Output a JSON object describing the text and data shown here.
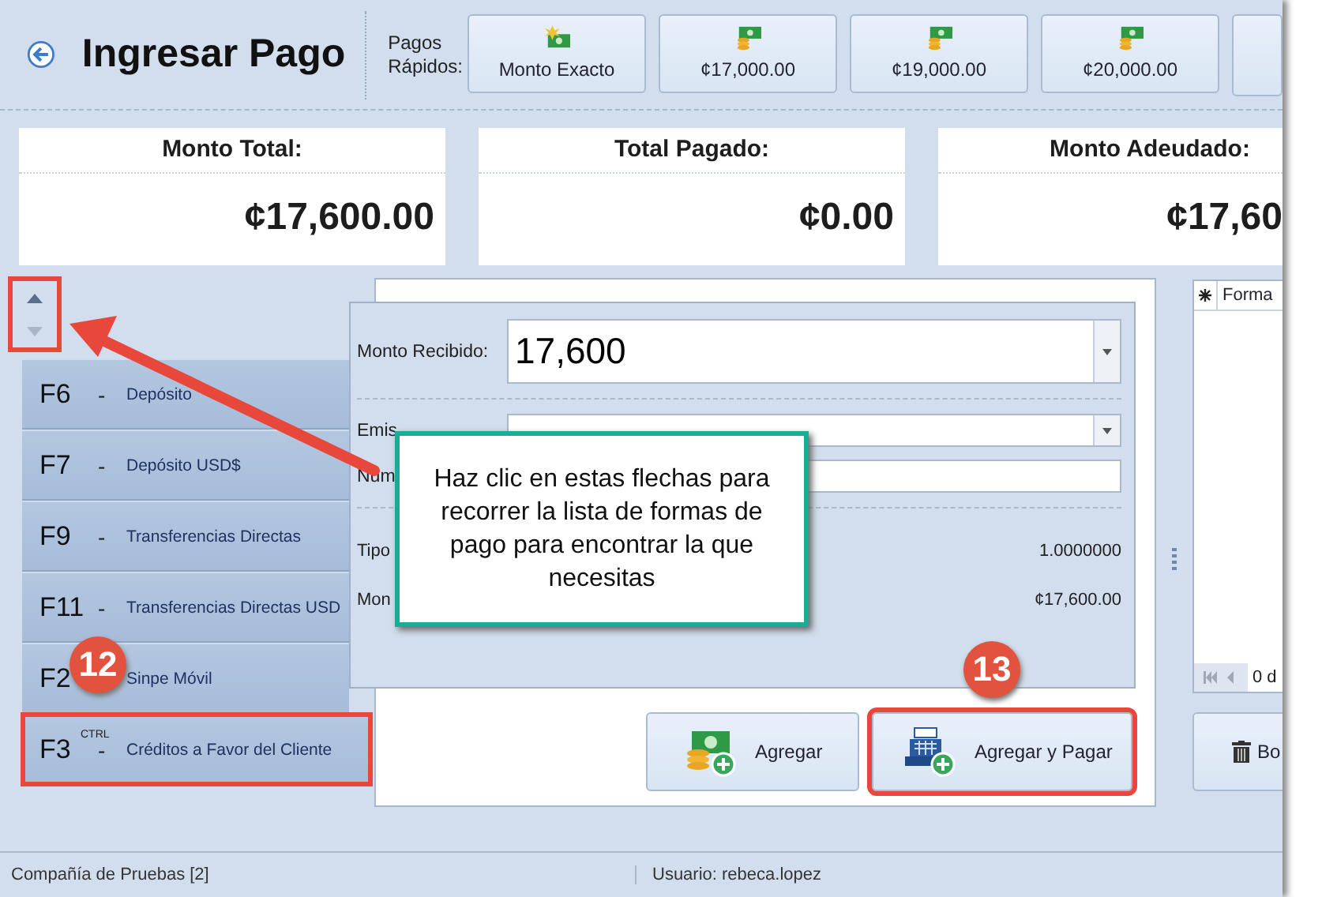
{
  "header": {
    "title": "Ingresar Pago",
    "quick_pay_label": "Pagos Rápidos:"
  },
  "quick_pay_buttons": [
    {
      "label": "Monto Exacto",
      "kind": "exact"
    },
    {
      "label": "¢17,000.00",
      "kind": "cash"
    },
    {
      "label": "¢19,000.00",
      "kind": "cash"
    },
    {
      "label": "¢20,000.00",
      "kind": "cash"
    }
  ],
  "summary": [
    {
      "title": "Monto Total:",
      "amount": "¢17,600.00"
    },
    {
      "title": "Total Pagado:",
      "amount": "¢0.00"
    },
    {
      "title": "Monto Adeudado:",
      "amount": "¢17,60"
    }
  ],
  "scroll_arrows": {
    "up_enabled": true,
    "down_enabled": false,
    "annotated": true
  },
  "payment_methods": [
    {
      "key": "F6",
      "separator": "-",
      "name": "Depósito",
      "annotated": false
    },
    {
      "key": "F7",
      "separator": "-",
      "name": "Depósito USD$",
      "annotated": false
    },
    {
      "key": "F9",
      "separator": "-",
      "name": "Transferencias Directas",
      "annotated": false
    },
    {
      "key": "F11",
      "separator": "-",
      "name": "Transferencias Directas USD",
      "annotated": false
    },
    {
      "key": "F2",
      "name": "Sinpe Móvil",
      "annotated": false,
      "badge": "12"
    },
    {
      "key": "F3",
      "modifier": "CTRL",
      "separator": "-",
      "name": "Créditos a Favor del Cliente",
      "annotated": true
    }
  ],
  "payment_form": {
    "fields": [
      {
        "label": "Monto Recibido:",
        "value": "17,600",
        "kind": "large-combo"
      },
      {
        "label": "Emis",
        "kind": "combo"
      },
      {
        "label": "Núm",
        "kind": "text"
      }
    ],
    "info": [
      {
        "label": "Tipo",
        "value": "1.0000000"
      },
      {
        "label": "Mon",
        "value": "¢17,600.00"
      }
    ]
  },
  "actions": [
    {
      "label": "Agregar",
      "kind": "add",
      "annotated": false
    },
    {
      "label": "Agregar y Pagar",
      "kind": "add-pay",
      "annotated": true,
      "badge": "13"
    }
  ],
  "right_panel": {
    "grid_header": "Forma",
    "pager": "0 d",
    "button": "Bo"
  },
  "status_bar": [
    "Compañía de Pruebas [2]",
    "Usuario: rebeca.lopez"
  ],
  "callout": "Haz clic en estas flechas para recorrer la lista de formas de pago para encontrar la que necesitas"
}
